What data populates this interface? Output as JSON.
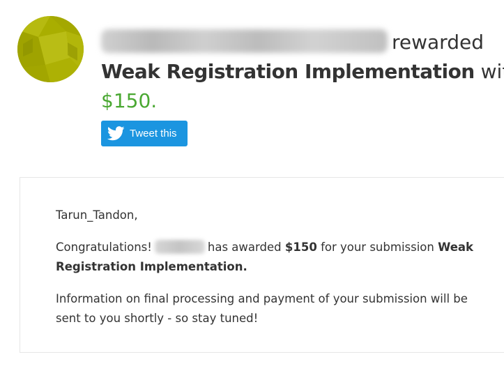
{
  "avatar": {
    "colors": {
      "base": "#a9ae00",
      "light": "#bcc017",
      "dark": "#8f9300"
    }
  },
  "headline": {
    "rewarded_text": "rewarded",
    "report_title": "Weak Registration Implementation",
    "with_text": "with",
    "amount": "$150."
  },
  "tweet_button": {
    "label": "Tweet this",
    "color": "#1b95e0"
  },
  "message": {
    "greeting": "Tarun_Tandon,",
    "congrats_prefix": "Congratulations!",
    "awarded_text": "has awarded",
    "amount": "$150",
    "submission_text": "for your submission",
    "report_title": "Weak Registration Implementation.",
    "info_text": "Information on final processing and payment of your submission will be sent to you shortly - so stay tuned!"
  },
  "colors": {
    "text": "#333333",
    "amount_green": "#4aa832",
    "card_border": "#e6e6e6"
  }
}
